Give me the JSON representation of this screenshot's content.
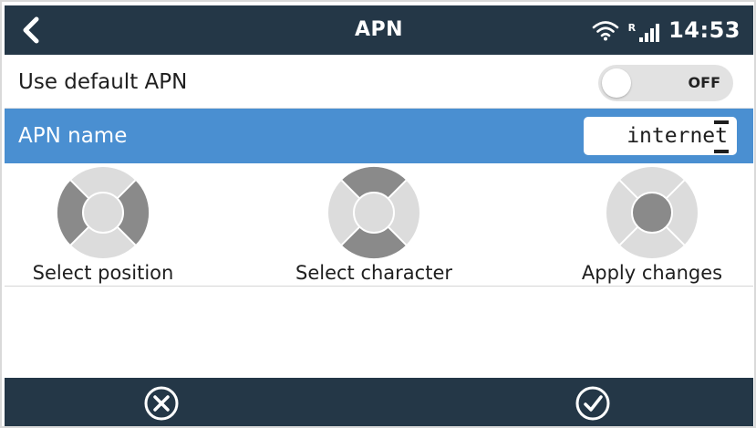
{
  "header": {
    "title": "APN",
    "time": "14:53",
    "signal_roaming_label": "R",
    "back_icon": "chevron-left-icon",
    "wifi_icon": "wifi-icon",
    "signal_icon": "cellular-signal-icon"
  },
  "default_apn": {
    "label": "Use default APN",
    "toggle_state": "OFF",
    "toggle_on": false
  },
  "apn_name": {
    "label": "APN name",
    "value_prefix": "interne",
    "value_cursor_char": "t",
    "selected": true
  },
  "help": {
    "select_position": {
      "label": "Select position",
      "icon": "dpad-left-right-icon"
    },
    "select_character": {
      "label": "Select character",
      "icon": "dpad-up-down-icon"
    },
    "apply_changes": {
      "label": "Apply changes",
      "icon": "dpad-center-icon"
    }
  },
  "footer": {
    "cancel_icon": "cancel-circle-x-icon",
    "confirm_icon": "confirm-circle-check-icon"
  },
  "colors": {
    "header_bg": "#243747",
    "selected_row": "#4a8fd1",
    "dpad_dark": "#8a8a8a",
    "dpad_light": "#dcdcdc"
  }
}
